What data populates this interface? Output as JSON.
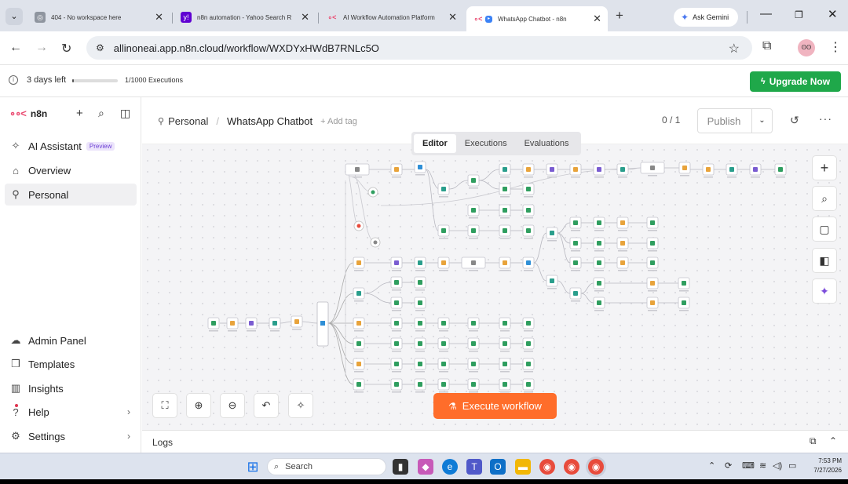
{
  "browser": {
    "tabs": [
      {
        "title": "404 - No workspace here",
        "favicon": "globe-icon"
      },
      {
        "title": "n8n automation - Yahoo Search R",
        "favicon": "yahoo-icon"
      },
      {
        "title": "AI Workflow Automation Platform",
        "favicon": "n8n-icon"
      },
      {
        "title": "WhatsApp Chatbot - n8n",
        "favicon": "n8n-icon",
        "active": true
      }
    ],
    "gemini_label": "Ask Gemini",
    "url": "allinoneai.app.n8n.cloud/workflow/WXDYxHWdB7RNLc5O"
  },
  "trial": {
    "days_left": "3 days left",
    "days_fraction": 0.02,
    "executions": "1/1000 Executions",
    "upgrade_label": "Upgrade Now"
  },
  "sidebar": {
    "brand": "n8n",
    "top_items": [
      {
        "label": "AI Assistant",
        "badge": "Preview"
      },
      {
        "label": "Overview"
      },
      {
        "label": "Personal",
        "selected": true
      }
    ],
    "bottom_items": [
      {
        "label": "Admin Panel"
      },
      {
        "label": "Templates"
      },
      {
        "label": "Insights"
      },
      {
        "label": "Help"
      },
      {
        "label": "Settings"
      }
    ]
  },
  "header": {
    "project": "Personal",
    "workflow_name": "WhatsApp Chatbot",
    "add_tag": "+ Add tag",
    "counter": "0 / 1",
    "publish_label": "Publish"
  },
  "canvas": {
    "tabs": [
      "Editor",
      "Executions",
      "Evaluations"
    ],
    "active_tab": "Editor",
    "execute_label": "Execute workflow"
  },
  "logs": {
    "label": "Logs"
  },
  "taskbar": {
    "search_placeholder": "Search",
    "time": "7:53 PM",
    "date": "7/27/2026"
  },
  "colors": {
    "accent_orange": "#ff6d2a",
    "upgrade_green": "#1fa84a",
    "n8n_pink": "#ea4b71"
  }
}
